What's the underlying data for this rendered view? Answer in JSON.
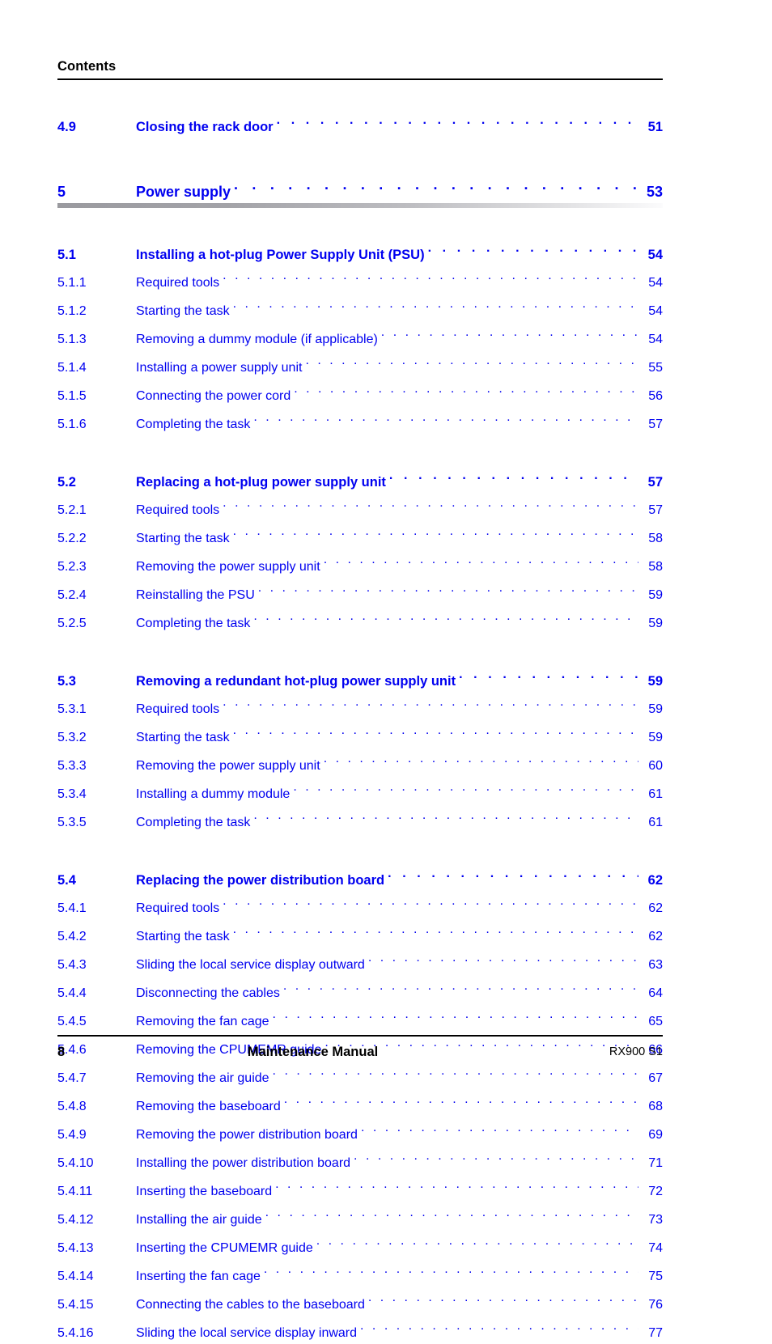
{
  "header": {
    "running_head": "Contents"
  },
  "toc": {
    "entries": [
      {
        "number": "4.9",
        "title": "Closing the rack door",
        "page": "51",
        "level": 2,
        "gap": "none",
        "rule": false
      },
      {
        "number": "5",
        "title": "Power supply",
        "page": "53",
        "level": 1,
        "gap": "xl",
        "rule": true
      },
      {
        "number": "5.1",
        "title": "Installing a hot-plug Power Supply Unit (PSU)",
        "page": "54",
        "level": 2,
        "gap": "lg",
        "rule": false
      },
      {
        "number": "5.1.1",
        "title": "Required tools",
        "page": "54",
        "level": 3,
        "gap": "none",
        "rule": false
      },
      {
        "number": "5.1.2",
        "title": "Starting the task",
        "page": "54",
        "level": 3,
        "gap": "none",
        "rule": false
      },
      {
        "number": "5.1.3",
        "title": "Removing a dummy module (if applicable)",
        "page": "54",
        "level": 3,
        "gap": "none",
        "rule": false
      },
      {
        "number": "5.1.4",
        "title": "Installing a power supply unit",
        "page": "55",
        "level": 3,
        "gap": "none",
        "rule": false
      },
      {
        "number": "5.1.5",
        "title": "Connecting the power cord",
        "page": "56",
        "level": 3,
        "gap": "none",
        "rule": false
      },
      {
        "number": "5.1.6",
        "title": "Completing the task",
        "page": "57",
        "level": 3,
        "gap": "none",
        "rule": false
      },
      {
        "number": "5.2",
        "title": "Replacing a hot-plug power supply unit",
        "page": "57",
        "level": 2,
        "gap": "lg",
        "rule": false
      },
      {
        "number": "5.2.1",
        "title": "Required tools",
        "page": "57",
        "level": 3,
        "gap": "none",
        "rule": false
      },
      {
        "number": "5.2.2",
        "title": "Starting the task",
        "page": "58",
        "level": 3,
        "gap": "none",
        "rule": false
      },
      {
        "number": "5.2.3",
        "title": "Removing the power supply unit",
        "page": "58",
        "level": 3,
        "gap": "none",
        "rule": false
      },
      {
        "number": "5.2.4",
        "title": "Reinstalling the PSU",
        "page": "59",
        "level": 3,
        "gap": "none",
        "rule": false
      },
      {
        "number": "5.2.5",
        "title": "Completing the task",
        "page": "59",
        "level": 3,
        "gap": "none",
        "rule": false
      },
      {
        "number": "5.3",
        "title": "Removing a redundant hot-plug power supply unit",
        "page": "59",
        "level": 2,
        "gap": "lg",
        "rule": false
      },
      {
        "number": "5.3.1",
        "title": "Required tools",
        "page": "59",
        "level": 3,
        "gap": "none",
        "rule": false
      },
      {
        "number": "5.3.2",
        "title": "Starting the task",
        "page": "59",
        "level": 3,
        "gap": "none",
        "rule": false
      },
      {
        "number": "5.3.3",
        "title": "Removing the power supply unit",
        "page": "60",
        "level": 3,
        "gap": "none",
        "rule": false
      },
      {
        "number": "5.3.4",
        "title": "Installing a dummy module",
        "page": "61",
        "level": 3,
        "gap": "none",
        "rule": false
      },
      {
        "number": "5.3.5",
        "title": "Completing the task",
        "page": "61",
        "level": 3,
        "gap": "none",
        "rule": false
      },
      {
        "number": "5.4",
        "title": "Replacing the power distribution board",
        "page": "62",
        "level": 2,
        "gap": "lg",
        "rule": false
      },
      {
        "number": "5.4.1",
        "title": "Required tools",
        "page": "62",
        "level": 3,
        "gap": "none",
        "rule": false
      },
      {
        "number": "5.4.2",
        "title": "Starting the task",
        "page": "62",
        "level": 3,
        "gap": "none",
        "rule": false
      },
      {
        "number": "5.4.3",
        "title": "Sliding the local service display outward",
        "page": "63",
        "level": 3,
        "gap": "none",
        "rule": false
      },
      {
        "number": "5.4.4",
        "title": "Disconnecting the cables",
        "page": "64",
        "level": 3,
        "gap": "none",
        "rule": false
      },
      {
        "number": "5.4.5",
        "title": "Removing the fan cage",
        "page": "65",
        "level": 3,
        "gap": "none",
        "rule": false
      },
      {
        "number": "5.4.6",
        "title": "Removing the CPUMEMR guide",
        "page": "66",
        "level": 3,
        "gap": "none",
        "rule": false
      },
      {
        "number": "5.4.7",
        "title": "Removing the air guide",
        "page": "67",
        "level": 3,
        "gap": "none",
        "rule": false
      },
      {
        "number": "5.4.8",
        "title": "Removing the baseboard",
        "page": "68",
        "level": 3,
        "gap": "none",
        "rule": false
      },
      {
        "number": "5.4.9",
        "title": "Removing the power distribution board",
        "page": "69",
        "level": 3,
        "gap": "none",
        "rule": false
      },
      {
        "number": "5.4.10",
        "title": "Installing the power distribution board",
        "page": "71",
        "level": 3,
        "gap": "none",
        "rule": false
      },
      {
        "number": "5.4.11",
        "title": "Inserting the baseboard",
        "page": "72",
        "level": 3,
        "gap": "none",
        "rule": false
      },
      {
        "number": "5.4.12",
        "title": "Installing the air guide",
        "page": "73",
        "level": 3,
        "gap": "none",
        "rule": false
      },
      {
        "number": "5.4.13",
        "title": "Inserting the CPUMEMR guide",
        "page": "74",
        "level": 3,
        "gap": "none",
        "rule": false
      },
      {
        "number": "5.4.14",
        "title": "Inserting the fan cage",
        "page": "75",
        "level": 3,
        "gap": "none",
        "rule": false
      },
      {
        "number": "5.4.15",
        "title": "Connecting the cables to the baseboard",
        "page": "76",
        "level": 3,
        "gap": "none",
        "rule": false
      },
      {
        "number": "5.4.16",
        "title": "Sliding the local service display inward",
        "page": "77",
        "level": 3,
        "gap": "none",
        "rule": false
      }
    ]
  },
  "footer": {
    "page_number": "8",
    "document_title": "Maintenance Manual",
    "product": "RX900 S1"
  },
  "colors": {
    "link_blue": "#0000f0",
    "text_black": "#000000",
    "rule_black": "#000000",
    "gradient_start": "#9a9a9f",
    "gradient_end": "#fbfbfc",
    "page_background": "#ffffff"
  }
}
